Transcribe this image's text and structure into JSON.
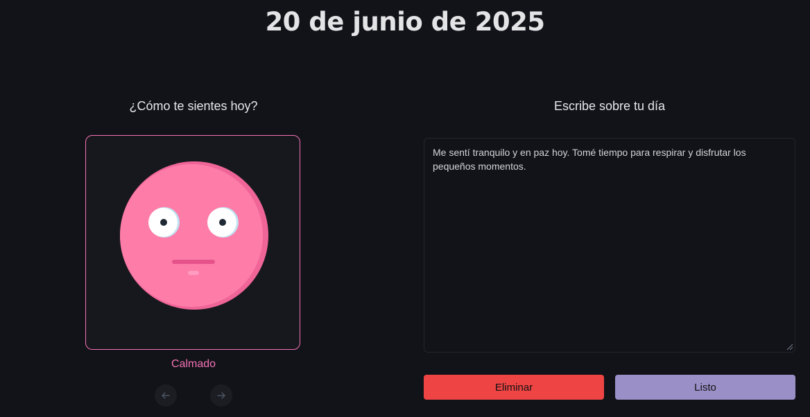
{
  "header": {
    "date": "20 de junio de 2025"
  },
  "mood": {
    "heading": "¿Cómo te sientes hoy?",
    "current_label": "Calmado",
    "face_icon": "calm-face-icon",
    "accent_color": "#f472b6",
    "prev_icon": "arrow-left-icon",
    "next_icon": "arrow-right-icon"
  },
  "journal": {
    "heading": "Escribe sobre tu día",
    "text": "Me sentí tranquilo y en paz hoy. Tomé tiempo para respirar y disfrutar los pequeños momentos."
  },
  "actions": {
    "delete_label": "Eliminar",
    "done_label": "Listo",
    "delete_color": "#ef4444",
    "done_color": "#9b8fc7"
  }
}
